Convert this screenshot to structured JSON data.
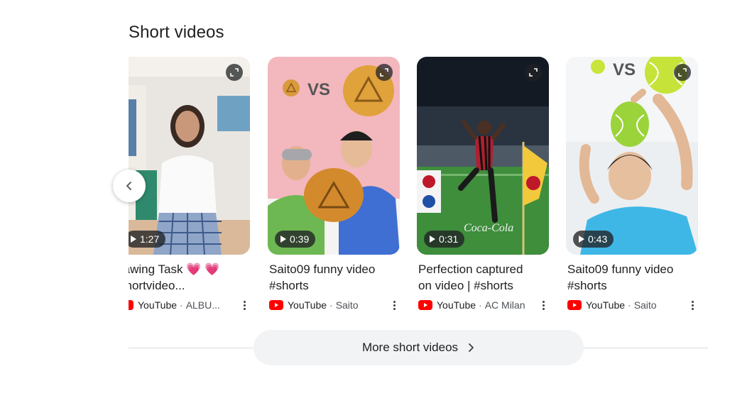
{
  "section": {
    "title": "Short videos"
  },
  "cards": [
    {
      "title": "rawing Task 💗 💗\nshortvideo...",
      "source": "YouTube",
      "channel": "ALBU...",
      "duration": "1:27"
    },
    {
      "title": "Saito09 funny video\n#shorts",
      "source": "YouTube",
      "channel": "Saito",
      "duration": "0:39",
      "overlay_text": "VS"
    },
    {
      "title": "Perfection captured\non video | #shorts",
      "source": "YouTube",
      "channel": "AC Milan",
      "duration": "0:31",
      "overlay_text": "Coca-Cola"
    },
    {
      "title": "Saito09 funny video\n#shorts",
      "source": "YouTube",
      "channel": "Saito",
      "duration": "0:43",
      "overlay_text": "VS"
    }
  ],
  "separator": "·",
  "more_button": {
    "label": "More short videos"
  },
  "icons": {
    "prev": "chevron-left-icon",
    "expand": "expand-icon",
    "play": "play-icon",
    "source": "youtube-icon",
    "menu": "more-vert-icon",
    "more": "chevron-right-icon"
  },
  "colors": {
    "youtube_red": "#ff0000",
    "button_bg": "#f1f3f4",
    "divider": "#dadce0"
  }
}
